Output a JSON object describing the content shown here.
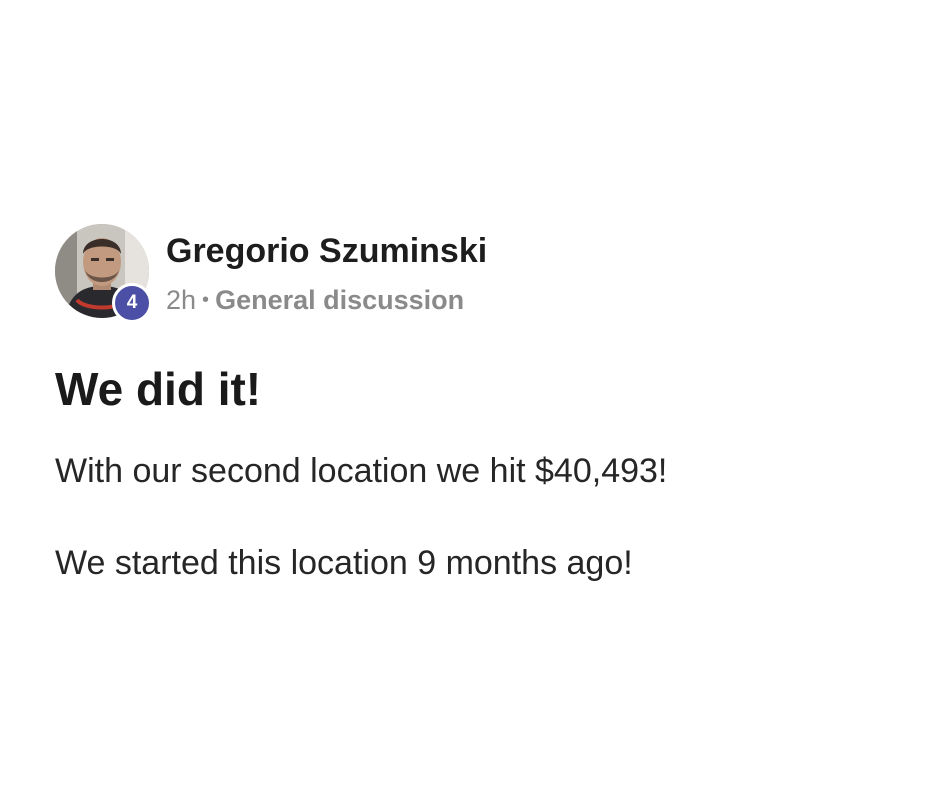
{
  "post": {
    "author": {
      "name": "Gregorio Szuminski",
      "level": "4",
      "avatar_icon": "user-avatar-photo"
    },
    "time": "2h",
    "separator": "•",
    "category": "General discussion",
    "title": "We did it!",
    "body": [
      "With our second location we hit $40,493!",
      "We started this location 9 months ago!"
    ]
  },
  "colors": {
    "badge": "#4b4fa6",
    "meta_text": "#8a8a8a",
    "text": "#222222"
  }
}
